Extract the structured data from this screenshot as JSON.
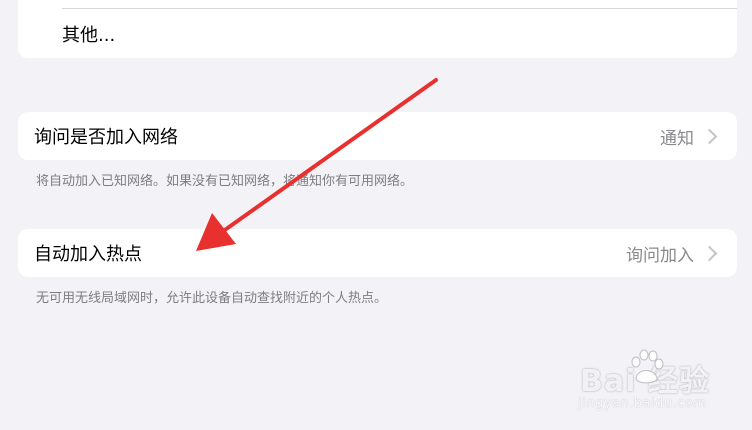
{
  "top_group": {
    "other_label": "其他..."
  },
  "ask_to_join": {
    "label": "询问是否加入网络",
    "value": "通知",
    "footnote": "将自动加入已知网络。如果没有已知网络，将通知你有可用网络。"
  },
  "auto_join_hotspot": {
    "label": "自动加入热点",
    "value": "询问加入",
    "footnote": "无可用无线局域网时，允许此设备自动查找附近的个人热点。"
  },
  "annotation": {
    "arrow_color": "#e8302f"
  },
  "watermark": {
    "brand": "Bai 经验",
    "url": "jingyan.baidu.com"
  },
  "colors": {
    "background": "#f2f2f7",
    "card": "#ffffff",
    "secondary_text": "#8a8a8e",
    "footnote_text": "#7d7d82"
  }
}
